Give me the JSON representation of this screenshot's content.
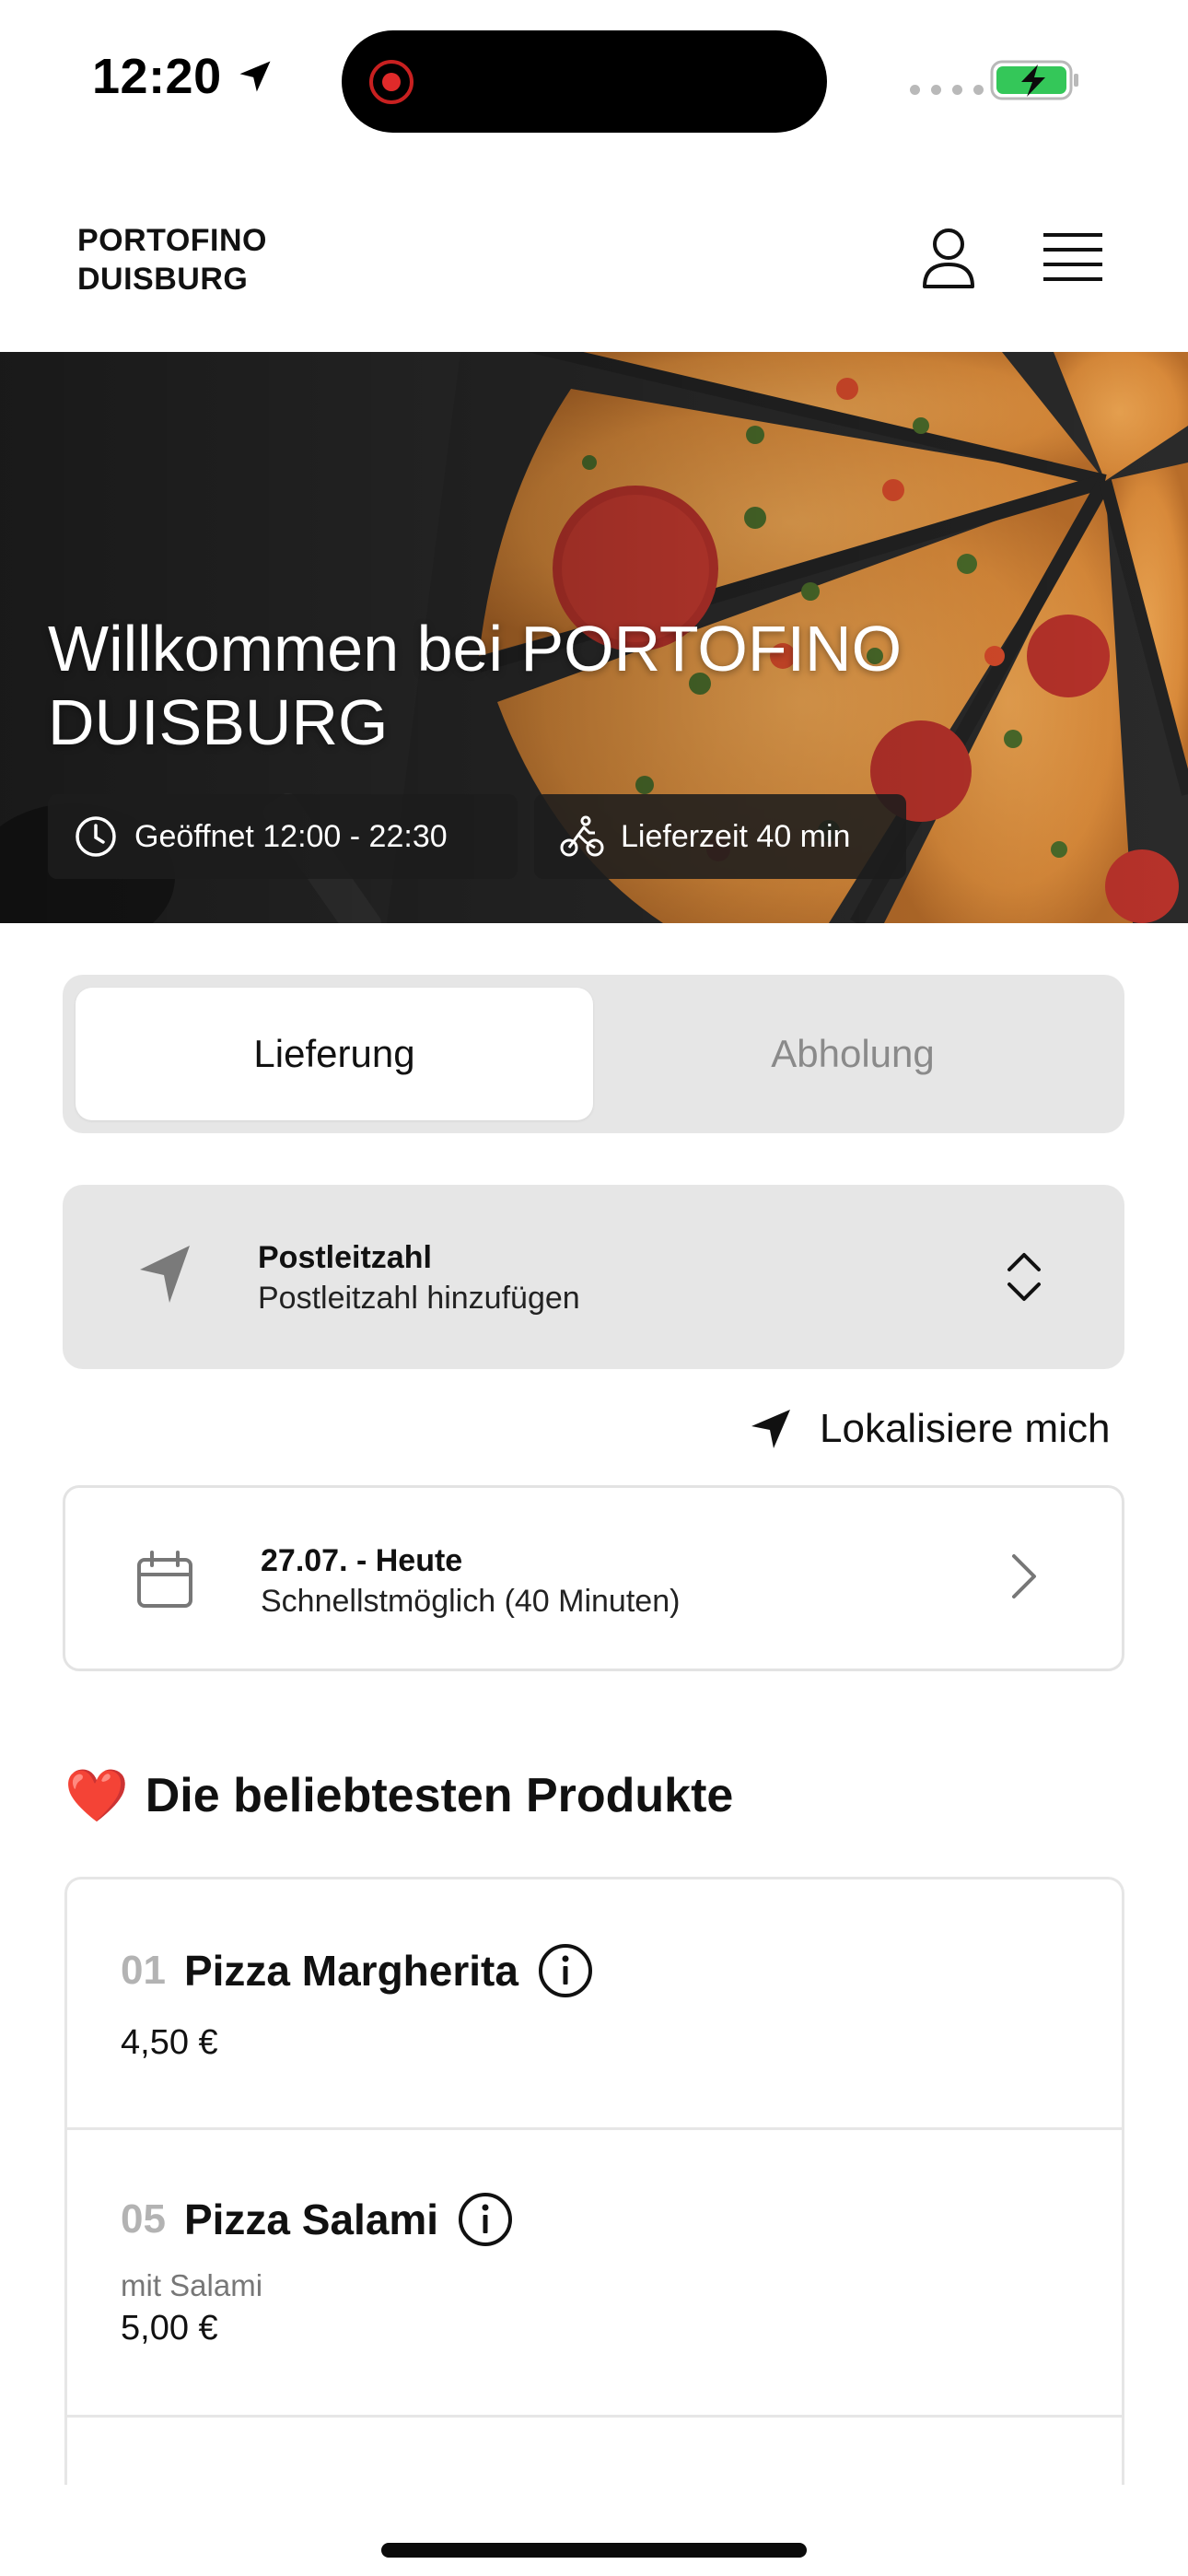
{
  "status_bar": {
    "time": "12:20"
  },
  "header": {
    "brand_line1": "PORTOFINO",
    "brand_line2": "DUISBURG",
    "user_icon": "user-icon",
    "menu_icon": "hamburger-menu-icon"
  },
  "hero": {
    "title_line1": "Willkommen bei PORTOFINO",
    "title_line2": "DUISBURG",
    "opening_hours": "Geöffnet 12:00 - 22:30",
    "delivery_time": "Lieferzeit 40 min"
  },
  "order_type": {
    "options": [
      "Lieferung",
      "Abholung"
    ],
    "selected": "Lieferung"
  },
  "postal_code": {
    "label": "Postleitzahl",
    "placeholder": "Postleitzahl hinzufügen"
  },
  "locate": {
    "label": "Lokalisiere mich"
  },
  "date_picker": {
    "date": "27.07. - Heute",
    "time": "Schnellstmöglich (40 Minuten)"
  },
  "popular": {
    "emoji": "❤️",
    "title": "Die beliebtesten Produkte",
    "products": [
      {
        "number": "01",
        "name": "Pizza Margherita",
        "description": "",
        "price": "4,50 €"
      },
      {
        "number": "05",
        "name": "Pizza Salami",
        "description": "mit Salami",
        "price": "5,00 €"
      }
    ]
  },
  "colors": {
    "accent": "#111111",
    "surface": "#e6e6e6",
    "muted_text": "#8a8a8a",
    "battery_green": "#34c759"
  }
}
